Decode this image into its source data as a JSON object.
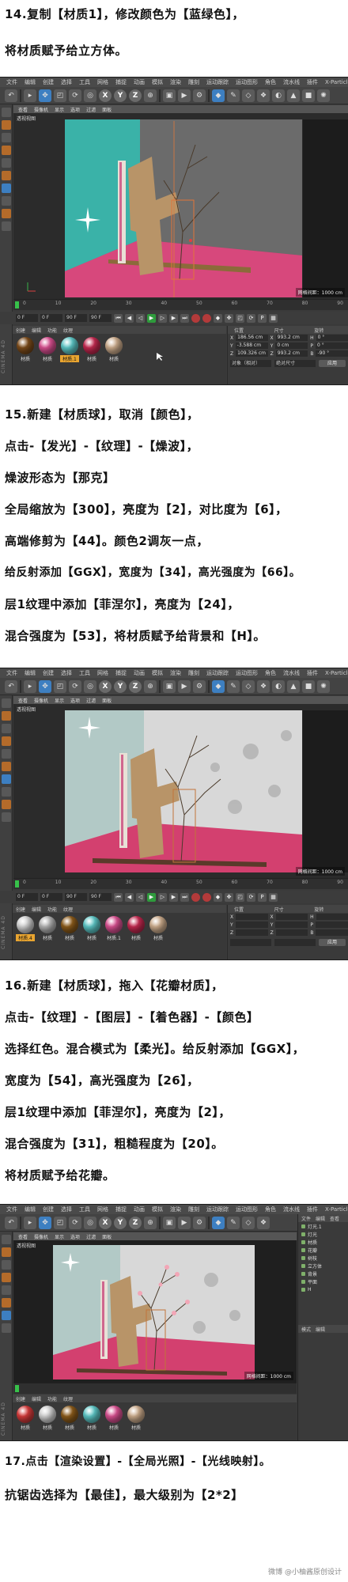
{
  "steps": [
    {
      "lines": [
        "14.复制【材质1】，修改颜色为【蓝绿色】，",
        "将材质赋予给立方体。"
      ]
    },
    {
      "lines": [
        "15.新建【材质球】，取消【颜色】，",
        "点击-【发光】-【纹理】-【燥波】，",
        "燥波形态为【那克】",
        "全局缩放为【300】，亮度为【2】，对比度为【6】，",
        "高端修剪为【44】。颜色2调灰一点，",
        "给反射添加【GGX】，宽度为【34】，高光强度为【66】。",
        "层1纹理中添加【菲涅尔】，亮度为【24】，",
        "混合强度为【53】，将材质赋予给背景和【H】。"
      ]
    },
    {
      "lines": [
        "16.新建【材质球】，拖入【花瓣材质】，",
        "点击-【纹理】-【图层】-【着色器】-【颜色】",
        "选择红色。混合模式为【柔光】。给反射添加【GGX】，",
        "宽度为【54】，高光强度为【26】，",
        "层1纹理中添加【菲涅尔】，亮度为【2】，",
        "混合强度为【31】，粗糙程度为【20】。",
        "将材质赋予给花瓣。"
      ]
    },
    {
      "lines": [
        "17.点击【渲染设置】-【全局光照】-【光线映射】。",
        "抗锯齿选择为【最佳】，最大级别为【2*2】"
      ]
    }
  ],
  "ui": {
    "menu": [
      "文件",
      "编辑",
      "创建",
      "选择",
      "工具",
      "网格",
      "捕捉",
      "动画",
      "模拟",
      "渲染",
      "雕刻",
      "运动跟踪",
      "运动图形",
      "角色",
      "流水线",
      "插件",
      "X-Particles",
      "脚本",
      "窗口",
      "帮助"
    ],
    "vp_menu": [
      "查看",
      "摄像机",
      "显示",
      "选项",
      "过滤",
      "面板"
    ],
    "vp_title": "透视视图",
    "vp_distance": "网格间距：1000 cm",
    "axis_labels": [
      "X",
      "Y",
      "Z"
    ],
    "ticks": [
      "0",
      "10",
      "20",
      "30",
      "40",
      "50",
      "60",
      "70",
      "80",
      "90"
    ],
    "frame_fields": [
      "0 F",
      "0 F",
      "90 F",
      "90 F"
    ],
    "mat_menu": [
      "创建",
      "编辑",
      "功能",
      "纹理"
    ],
    "logo_text": "CINEMA 4D",
    "coords_head": [
      "位置",
      "尺寸",
      "旋转"
    ],
    "coords_rows": [
      [
        "X",
        "186.56 cm",
        "X",
        "993.2 cm",
        "H",
        "0 °"
      ],
      [
        "Y",
        "-3.588 cm",
        "Y",
        "0 cm",
        "P",
        "0 °"
      ],
      [
        "Z",
        "109.326 cm",
        "Z",
        "993.2 cm",
        "B",
        "-90 °"
      ]
    ],
    "coords_foot": [
      "对象（相对）",
      "绝对尺寸",
      "应用"
    ],
    "objects": [
      "文件",
      "编辑",
      "查看",
      "对象",
      "标签",
      "书签"
    ],
    "object_items": [
      "灯光.1",
      "灯光",
      "材质",
      "花瓣",
      "树枝",
      "立方体",
      "背景",
      "平面",
      "H"
    ],
    "panel_tabs": [
      "模式",
      "编辑",
      "用户数据"
    ]
  },
  "shot1": {
    "materials": [
      {
        "name": "材质",
        "color": "#7a4a1a"
      },
      {
        "name": "材质",
        "color": "#d64f8f"
      },
      {
        "name": "材质.1",
        "color": "#5bc4c4",
        "selected": true
      },
      {
        "name": "材质",
        "color": "#c2284f"
      },
      {
        "name": "材质",
        "color": "#c9a98a"
      }
    ]
  },
  "shot2": {
    "materials": [
      {
        "name": "材质.4",
        "color": "#cfcfcf",
        "selected": true
      },
      {
        "name": "材质",
        "color": "#b0b0b0"
      },
      {
        "name": "材质",
        "color": "#8a5a1a"
      },
      {
        "name": "材质",
        "color": "#5bc4c4"
      },
      {
        "name": "材质.1",
        "color": "#d64f8f"
      },
      {
        "name": "材质",
        "color": "#c2284f"
      },
      {
        "name": "材质",
        "color": "#c9a98a"
      }
    ]
  },
  "shot3": {
    "materials": [
      {
        "name": "材质",
        "color": "#d23a3a"
      },
      {
        "name": "材质",
        "color": "#cfcfcf"
      },
      {
        "name": "材质",
        "color": "#8a5a1a"
      },
      {
        "name": "材质",
        "color": "#5bc4c4"
      },
      {
        "name": "材质",
        "color": "#d64f8f"
      },
      {
        "name": "材质",
        "color": "#c9a98a"
      }
    ]
  },
  "watermark": "微博 @小柚酱原创设计"
}
